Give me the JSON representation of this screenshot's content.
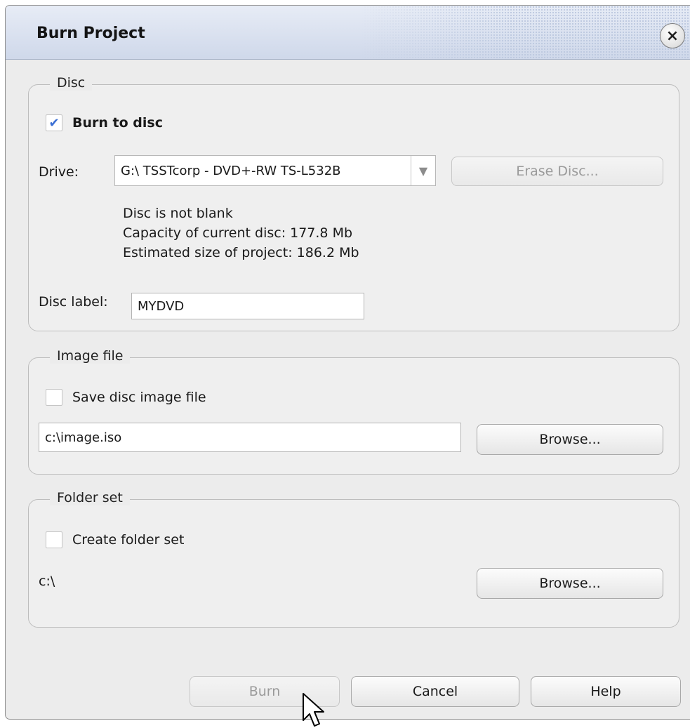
{
  "window": {
    "title": "Burn Project",
    "close_glyph": "×"
  },
  "disc": {
    "legend": "Disc",
    "burn_to_disc": {
      "label": "Burn to disc",
      "checked": true
    },
    "drive": {
      "label": "Drive:",
      "value": "G:\\ TSSTcorp - DVD+-RW TS-L532B"
    },
    "erase_button": "Erase Disc...",
    "status": "Disc is not blank",
    "capacity": "Capacity of current disc: 177.8 Mb",
    "estimated": "Estimated size of project: 186.2 Mb",
    "label_field": {
      "label": "Disc label:",
      "value": "MYDVD"
    }
  },
  "image_file": {
    "legend": "Image file",
    "save_image": {
      "label": "Save disc image file",
      "checked": false
    },
    "path": "c:\\image.iso",
    "browse_button": "Browse..."
  },
  "folder_set": {
    "legend": "Folder set",
    "create_folder_set": {
      "label": "Create folder set",
      "checked": false
    },
    "path": "c:\\",
    "browse_button": "Browse..."
  },
  "footer": {
    "burn": "Burn",
    "cancel": "Cancel",
    "help": "Help"
  },
  "icons": {
    "check": "✔",
    "dropdown": "▼",
    "cursor": "mouse-pointer"
  },
  "colors": {
    "checkmark": "#3b6fd4",
    "titlebar": "#cfd8ea"
  }
}
